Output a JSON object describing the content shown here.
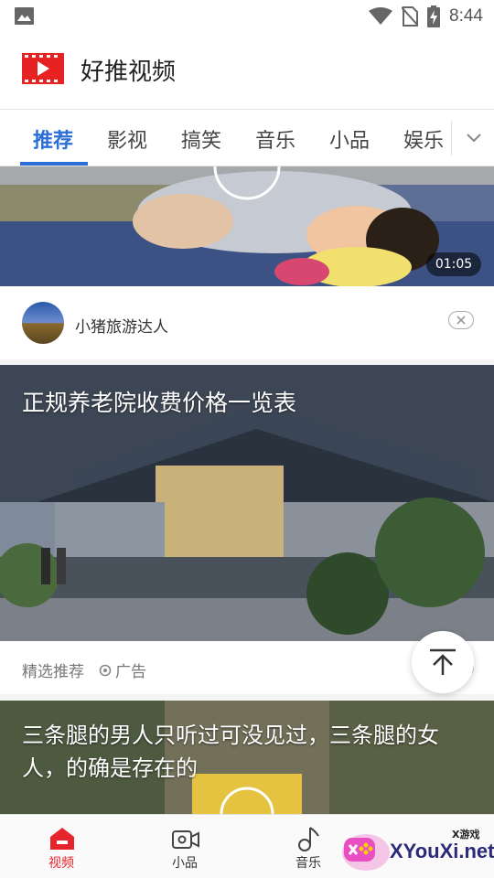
{
  "status_bar": {
    "time": "8:44"
  },
  "app": {
    "title": "好推视频"
  },
  "tabs": [
    {
      "label": "推荐",
      "active": true
    },
    {
      "label": "影视",
      "active": false
    },
    {
      "label": "搞笑",
      "active": false
    },
    {
      "label": "音乐",
      "active": false
    },
    {
      "label": "小品",
      "active": false
    },
    {
      "label": "娱乐",
      "active": false
    }
  ],
  "feed": {
    "video1": {
      "duration": "01:05",
      "author": "小猪旅游达人"
    },
    "ad": {
      "title": "正规养老院收费价格一览表",
      "source": "精选推荐",
      "tag": "广告"
    },
    "video3": {
      "title": "三条腿的男人只听过可没见过，三条腿的女人，的确是存在的"
    }
  },
  "bottom_nav": [
    {
      "label": "视频",
      "icon": "home-video-icon",
      "active": true
    },
    {
      "label": "小品",
      "icon": "camera-icon",
      "active": false
    },
    {
      "label": "音乐",
      "icon": "music-note-icon",
      "active": false
    }
  ],
  "watermark": {
    "text": "XYouXi.net",
    "small": "X游戏"
  },
  "colors": {
    "accent": "#2b6fd6",
    "active_nav": "#e6242b"
  }
}
